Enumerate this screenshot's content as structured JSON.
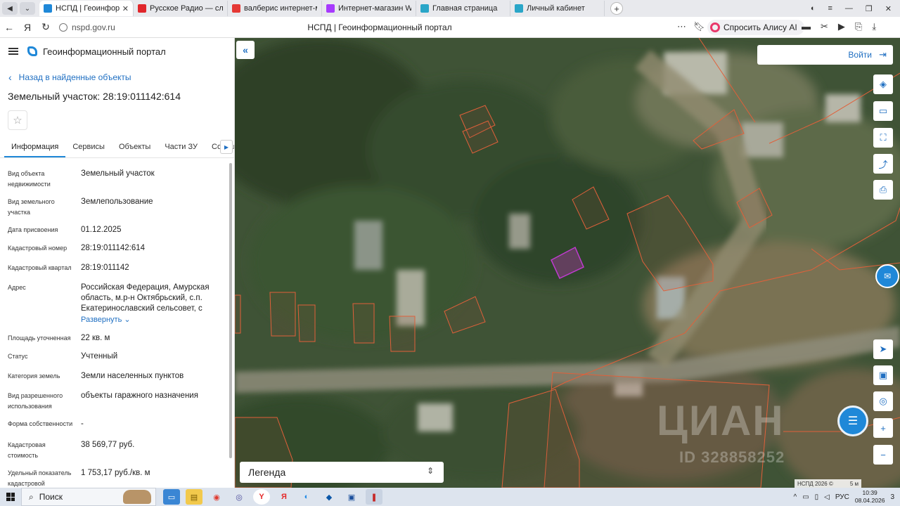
{
  "browser": {
    "tabs": [
      {
        "title": "НСПД | Геоинформационный",
        "color": "#1f88d8",
        "active": true
      },
      {
        "title": "Русское Радио — слушать онлайн",
        "color": "#e0262b",
        "active": false
      },
      {
        "title": "валберис интернет-магазин",
        "color": "#e53935",
        "active": false
      },
      {
        "title": "Интернет-магазин Wildberries",
        "color": "#a73afd",
        "active": false
      },
      {
        "title": "Главная страница",
        "color": "#2aa6c8",
        "active": false
      },
      {
        "title": "Личный кабинет",
        "color": "#2aa6c8",
        "active": false
      }
    ],
    "url": "nspd.gov.ru",
    "page_title": "НСПД | Геоинформационный портал",
    "alice_label": "Спросить Алису AI",
    "new_tab": "+"
  },
  "sidebar": {
    "portal_name": "Геоинформационный портал",
    "back_label": "Назад в найденные объекты",
    "title": "Земельный участок: 28:19:011142:614",
    "tabs": [
      "Информация",
      "Сервисы",
      "Объекты",
      "Части ЗУ",
      "Состав"
    ],
    "props": [
      {
        "key": "Вид объекта недвижимости",
        "value": "Земельный участок"
      },
      {
        "key": "Вид земельного участка",
        "value": "Землепользование"
      },
      {
        "key": "Дата присвоения",
        "value": "01.12.2025"
      },
      {
        "key": "Кадастровый номер",
        "value": "28:19:011142:614"
      },
      {
        "key": "Кадастровый квартал",
        "value": "28:19:011142"
      },
      {
        "key": "Адрес",
        "value": "Российская Федерация, Амурская область, м.р-н Октябрьский, с.п. Екатеринославский сельсовет, с"
      },
      {
        "key": "Площадь уточненная",
        "value": "22 кв. м"
      },
      {
        "key": "Статус",
        "value": "Учтенный"
      },
      {
        "key": "Категория земель",
        "value": "Земли населенных пунктов"
      },
      {
        "key": "Вид разрешенного использования",
        "value": "объекты гаражного назначения"
      },
      {
        "key": "Форма собственности",
        "value": "-"
      },
      {
        "key": "Кадастровая стоимость",
        "value": "38 569,77 руб."
      },
      {
        "key": "Удельный показатель кадастровой",
        "value": "1 753,17 руб./кв. м"
      }
    ],
    "expand_label": "Развернуть"
  },
  "map": {
    "login_label": "Войти",
    "legend_label": "Легенда",
    "watermark": "ЦИАН",
    "watermark_id": "ID 328858252",
    "attribution": "НСПД 2026 ©",
    "scale": "5 м",
    "parcel_color": "#e0603a",
    "selected_color": "#c03bd0"
  },
  "taskbar": {
    "search_label": "Поиск",
    "lang": "РУС",
    "time": "10:39",
    "date": "08.04.2026",
    "notifications": "3"
  }
}
